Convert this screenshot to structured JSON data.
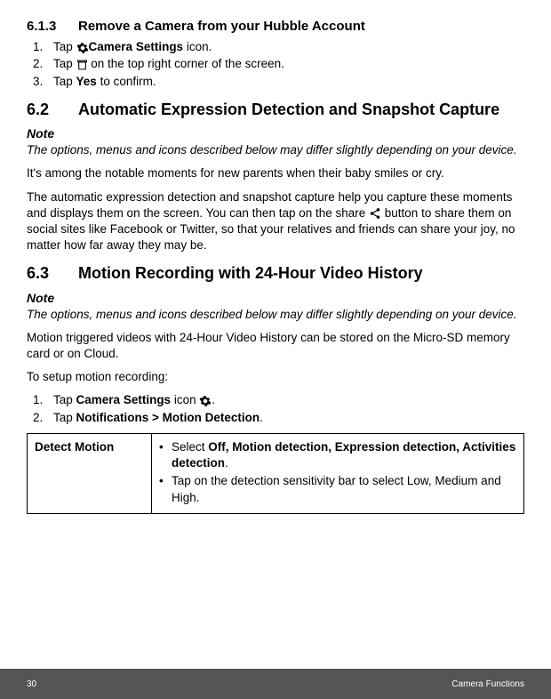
{
  "section_613": {
    "number": "6.1.3",
    "title": "Remove a Camera from your Hubble Account",
    "steps": [
      {
        "pre": "Tap ",
        "icon": "gear-icon",
        "bold": "Camera Settings",
        "post": " icon."
      },
      {
        "pre": "Tap ",
        "icon": "trash-icon",
        "post": " on the top right corner of the screen."
      },
      {
        "pre": "Tap ",
        "bold": "Yes",
        "post": " to confirm."
      }
    ]
  },
  "section_62": {
    "number": "6.2",
    "title": "Automatic Expression Detection and Snapshot Capture",
    "note_label": "Note",
    "note_body": "The options, menus and icons described below may differ slightly depending on your device.",
    "para1": "It's among the notable moments for new parents when their baby smiles or cry.",
    "para2_a": "The automatic expression detection and snapshot capture help you capture these moments and displays them on the screen. You can then tap on the share ",
    "para2_b": " button to share them on social sites like Facebook or Twitter, so that your relatives and friends can share your joy, no matter how far away they may be."
  },
  "section_63": {
    "number": "6.3",
    "title": "Motion Recording with 24-Hour Video History",
    "note_label": "Note",
    "note_body": "The options, menus and icons described below may differ slightly depending on your device.",
    "para1": "Motion triggered videos with 24-Hour Video History can be stored on the Micro-SD memory card or on Cloud.",
    "para2": "To setup motion recording:",
    "steps": [
      {
        "pre": "Tap ",
        "bold": "Camera Settings",
        "mid": " icon ",
        "icon": "gear-icon",
        "post": "."
      },
      {
        "pre": "Tap ",
        "bold": "Notifications > Motion Detection",
        "post": "."
      }
    ],
    "table": {
      "label": "Detect Motion",
      "b1_pre": "Select ",
      "b1_bold": "Off, Motion detection, Expression detection, Activities detection",
      "b1_post": ".",
      "b2": "Tap on the detection sensitivity bar to select Low, Medium and High."
    }
  },
  "footer": {
    "page": "30",
    "label": "Camera Functions"
  }
}
